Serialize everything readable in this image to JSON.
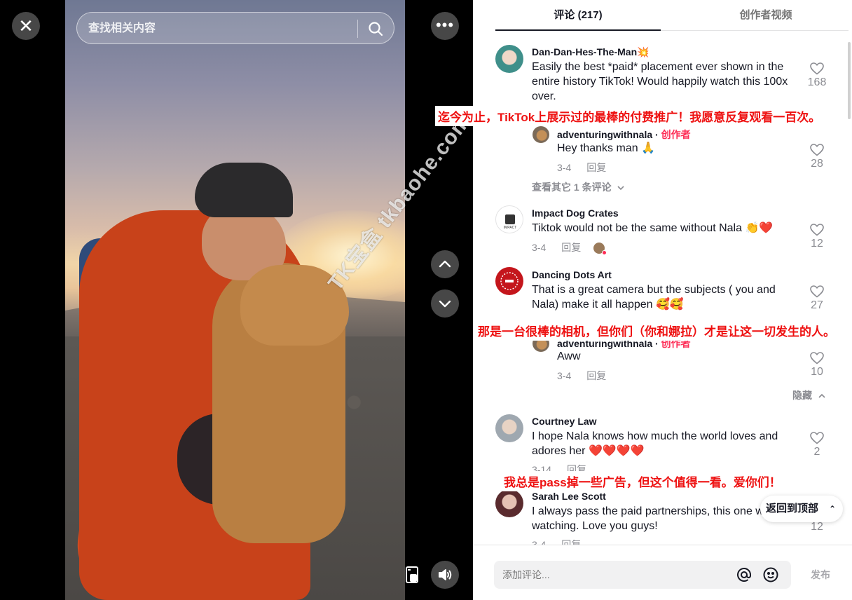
{
  "video": {
    "close_label": "✕",
    "search_placeholder": "查找相关内容",
    "more_label": "•••",
    "watermark": "TK宝盒 tkbaohe.com"
  },
  "tabs": [
    {
      "label": "评论 (217)",
      "active": true
    },
    {
      "label": "创作者视频",
      "active": false
    }
  ],
  "comments": [
    {
      "user": "Dan-Dan-Hes-The-Man💥",
      "text": "Easily the best *paid* placement ever shown in the entire history TikTok! Would happily watch this 100x over.",
      "likes": "168",
      "translation": "迄今为止，TikTok上展示过的最棒的付费推广！我愿意反复观看一百次。",
      "reply": {
        "user": "adventuringwithnala",
        "tag": "创作者",
        "text": "Hey thanks man 🙏",
        "date": "3-4",
        "reply_label": "回复",
        "likes": "28"
      },
      "view_more": "查看其它 1 条评论"
    },
    {
      "user": "Impact Dog Crates",
      "text": "Tiktok would not be the same without Nala 👏❤️",
      "date": "3-4",
      "reply_label": "回复",
      "likes": "12"
    },
    {
      "user": "Dancing Dots Art",
      "text": "That is a great camera but the subjects ( you and Nala) make it all happen 🥰🥰",
      "likes": "27",
      "translation": "那是一台很棒的相机，但你们（你和娜拉）才是让这一切发生的人。",
      "reply": {
        "user": "adventuringwithnala",
        "tag": "创作者",
        "text": "Aww",
        "date": "3-4",
        "reply_label": "回复",
        "likes": "10"
      },
      "hide_label": "隐藏"
    },
    {
      "user": "Courtney Law",
      "text": "I hope Nala knows how much the world loves and adores her ❤️❤️❤️❤️",
      "date": "3-14",
      "reply_label": "回复",
      "likes": "2",
      "translation": "我总是pass掉一些广告，但这个值得一看。爱你们！"
    },
    {
      "user": "Sarah Lee Scott",
      "text": "I always pass the paid partnerships, this one worth watching. Love you guys!",
      "date": "3-4",
      "reply_label": "回复",
      "likes": "12"
    }
  ],
  "back_to_top": "返回到顶部",
  "composer": {
    "placeholder": "添加评论...",
    "post_label": "发布"
  },
  "colors": {
    "accent": "#fe2c55",
    "translation_red": "#ee1111",
    "text_primary": "#161823",
    "text_secondary": "#8a8b91"
  }
}
